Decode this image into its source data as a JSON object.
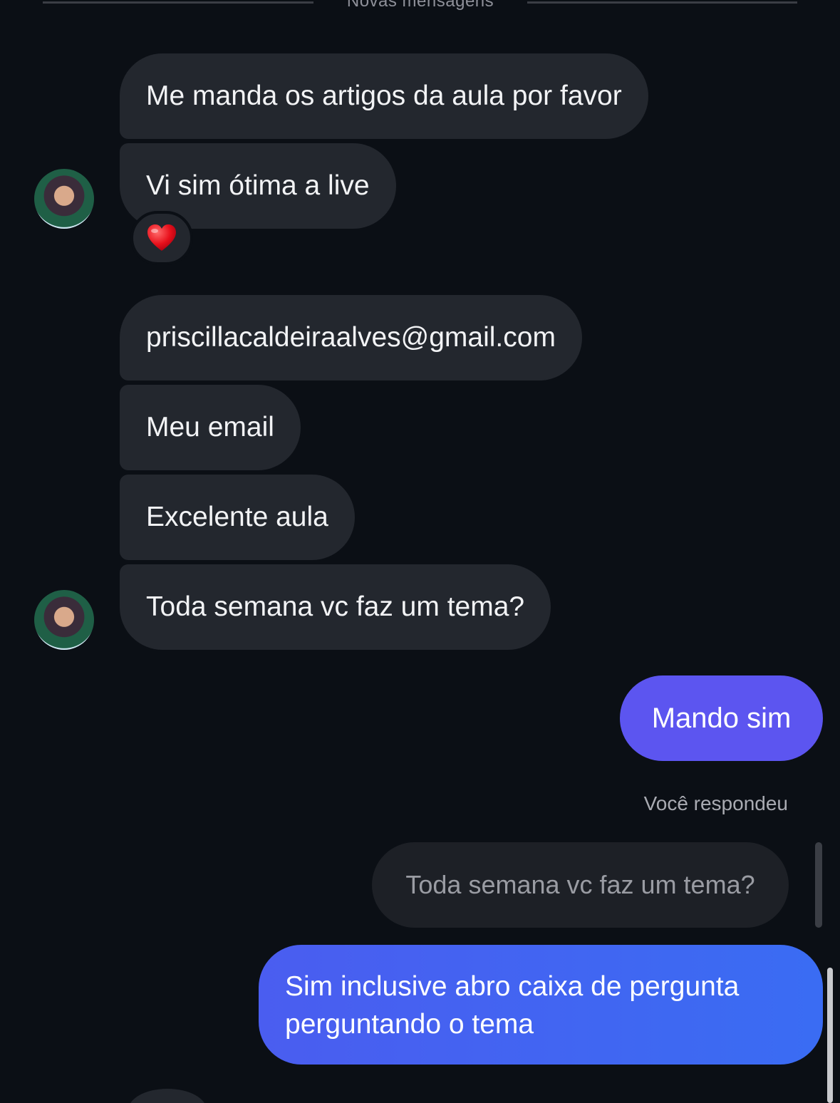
{
  "divider": {
    "label": "Novas mensagens"
  },
  "messages_in": [
    {
      "text": "Me manda os artigos da aula por favor"
    },
    {
      "text": "Vi sim ótima a live",
      "reaction": "❤️"
    },
    {
      "text": "priscillacaldeiraalves@gmail.com"
    },
    {
      "text": "Meu email"
    },
    {
      "text": "Excelente aula"
    },
    {
      "text": "Toda semana vc faz um tema?"
    }
  ],
  "message_out_1": {
    "text": "Mando sim"
  },
  "reply": {
    "label": "Você respondeu",
    "quoted_text": "Toda semana vc faz um tema?",
    "text": "Sim inclusive abro caixa de pergunta perguntando o tema"
  },
  "colors": {
    "background": "#0b0f15",
    "bubble_in": "#23272e",
    "bubble_out_purple": "#5c55f0",
    "bubble_out_blue": "#3a6cf3"
  },
  "icons": {
    "avatar": "profile-photo",
    "reaction": "red-heart"
  }
}
